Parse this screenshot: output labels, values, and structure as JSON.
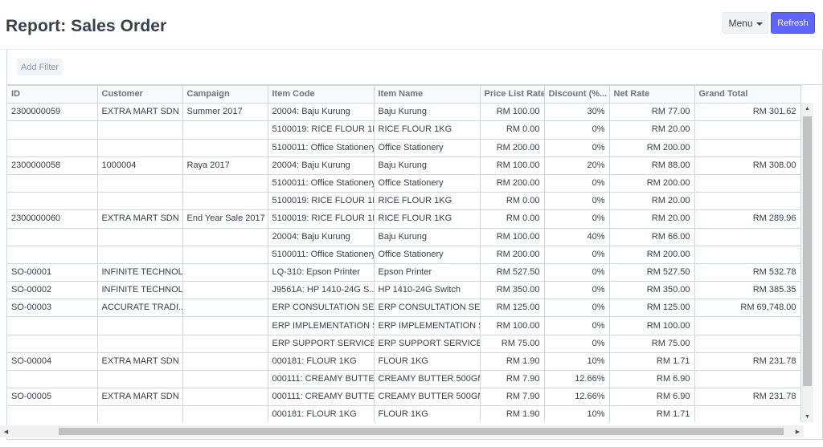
{
  "page": {
    "title": "Report: Sales Order",
    "menu_label": "Menu",
    "refresh_label": "Refresh",
    "add_filter_label": "Add Filter"
  },
  "table": {
    "columns": [
      "ID",
      "Customer",
      "Campaign",
      "Item Code",
      "Item Name",
      "Price List Rate",
      "Discount (%...",
      "Net Rate",
      "Grand Total"
    ],
    "rows": [
      [
        "2300000059",
        "EXTRA MART SDN ...",
        "Summer 2017",
        "20004: Baju Kurung",
        "Baju Kurung",
        "RM 100.00",
        "30%",
        "RM 77.00",
        "RM 301.62"
      ],
      [
        "",
        "",
        "",
        "5100019: RICE FLOUR 1KG",
        "RICE FLOUR 1KG",
        "RM 0.00",
        "0%",
        "RM 20.00",
        ""
      ],
      [
        "",
        "",
        "",
        "5100011: Office Stationery",
        "Office Stationery",
        "RM 200.00",
        "0%",
        "RM 200.00",
        ""
      ],
      [
        "2300000058",
        "1000004",
        "Raya 2017",
        "20004: Baju Kurung",
        "Baju Kurung",
        "RM 100.00",
        "20%",
        "RM 88.00",
        "RM 308.00"
      ],
      [
        "",
        "",
        "",
        "5100011: Office Stationery",
        "Office Stationery",
        "RM 200.00",
        "0%",
        "RM 200.00",
        ""
      ],
      [
        "",
        "",
        "",
        "5100019: RICE FLOUR 1KG",
        "RICE FLOUR 1KG",
        "RM 0.00",
        "0%",
        "RM 20.00",
        ""
      ],
      [
        "2300000060",
        "EXTRA MART SDN ...",
        "End Year Sale 2017",
        "5100019: RICE FLOUR 1KG",
        "RICE FLOUR 1KG",
        "RM 0.00",
        "0%",
        "RM 20.00",
        "RM 289.96"
      ],
      [
        "",
        "",
        "",
        "20004: Baju Kurung",
        "Baju Kurung",
        "RM 100.00",
        "40%",
        "RM 66.00",
        ""
      ],
      [
        "",
        "",
        "",
        "5100011: Office Stationery",
        "Office Stationery",
        "RM 200.00",
        "0%",
        "RM 200.00",
        ""
      ],
      [
        "SO-00001",
        "INFINITE TECHNOL...",
        "",
        "LQ-310: Epson Printer",
        "Epson Printer",
        "RM 527.50",
        "0%",
        "RM 527.50",
        "RM 532.78"
      ],
      [
        "SO-00002",
        "INFINITE TECHNOL...",
        "",
        "J9561A: HP 1410-24G S...",
        "HP 1410-24G Switch",
        "RM 350.00",
        "0%",
        "RM 350.00",
        "RM 385.35"
      ],
      [
        "SO-00003",
        "ACCURATE TRADI...",
        "",
        "ERP CONSULTATION SER...",
        "ERP CONSULTATION SER...",
        "RM 125.00",
        "0%",
        "RM 125.00",
        "RM 69,748.00"
      ],
      [
        "",
        "",
        "",
        "ERP IMPLEMENTATION S...",
        "ERP IMPLEMENTATION S...",
        "RM 100.00",
        "0%",
        "RM 100.00",
        ""
      ],
      [
        "",
        "",
        "",
        "ERP SUPPORT SERVICES",
        "ERP SUPPORT SERVICES",
        "RM 75.00",
        "0%",
        "RM 75.00",
        ""
      ],
      [
        "SO-00004",
        "EXTRA MART SDN ...",
        "",
        "000181: FLOUR 1KG",
        "FLOUR 1KG",
        "RM 1.90",
        "10%",
        "RM 1.71",
        "RM 231.78"
      ],
      [
        "",
        "",
        "",
        "000111: CREAMY BUTTE...",
        "CREAMY BUTTER 500GM",
        "RM 7.90",
        "12.66%",
        "RM 6.90",
        ""
      ],
      [
        "SO-00005",
        "EXTRA MART SDN ...",
        "",
        "000111: CREAMY BUTTE...",
        "CREAMY BUTTER 500GM",
        "RM 7.90",
        "12.66%",
        "RM 6.90",
        "RM 231.78"
      ],
      [
        "",
        "",
        "",
        "000181: FLOUR 1KG",
        "FLOUR 1KG",
        "RM 1.90",
        "10%",
        "RM 1.71",
        ""
      ],
      [
        "",
        "",
        "",
        "",
        "",
        "",
        "",
        "",
        ""
      ]
    ]
  },
  "colors": {
    "primary": "#5e64ff",
    "text": "#36414c",
    "muted": "#8d99a6",
    "border": "#d1d8dd",
    "header_bg": "#f7fafc"
  },
  "icons": {
    "menu_caret": "caret-down-icon",
    "scroll_up": "arrow-up-icon",
    "scroll_down": "arrow-down-icon",
    "scroll_left": "arrow-left-icon",
    "scroll_right": "arrow-right-icon"
  }
}
